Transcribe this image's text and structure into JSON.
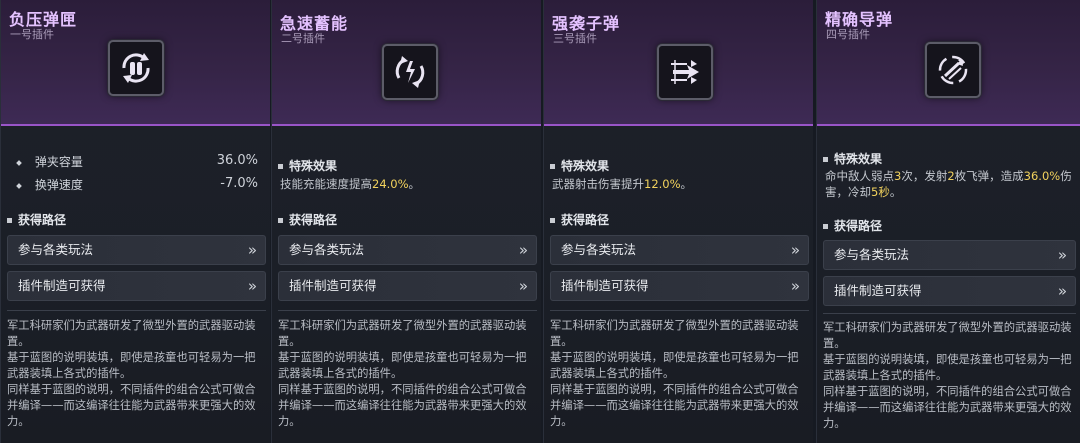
{
  "cards": [
    {
      "title": "负压弹匣",
      "subtitle": "一号插件",
      "icon": "ammo-cycle-icon",
      "stats": [
        {
          "label": "弹夹容量",
          "value": "36.0%"
        },
        {
          "label": "换弹速度",
          "value": "-7.0%"
        }
      ],
      "obtain_title": "获得路径",
      "buttons": [
        "参与各类玩法",
        "插件制造可获得"
      ],
      "description": [
        "军工科研家们为武器研发了微型外置的武器驱动装置。",
        "基于蓝图的说明装填，即使是孩童也可轻易为一把武器装填上各式的插件。",
        "同样基于蓝图的说明，不同插件的组合公式可做合并编译——而这编译往往能为武器带来更强大的效力。"
      ]
    },
    {
      "title": "急速蓄能",
      "subtitle": "二号插件",
      "icon": "energy-charge-icon",
      "effect_title": "特殊效果",
      "effect": {
        "pre": "技能充能速度提高",
        "hl": "24.0%",
        "post": "。"
      },
      "obtain_title": "获得路径",
      "buttons": [
        "参与各类玩法",
        "插件制造可获得"
      ],
      "description": [
        "军工科研家们为武器研发了微型外置的武器驱动装置。",
        "基于蓝图的说明装填，即使是孩童也可轻易为一把武器装填上各式的插件。",
        "同样基于蓝图的说明，不同插件的组合公式可做合并编译——而这编译往往能为武器带来更强大的效力。"
      ]
    },
    {
      "title": "强袭子弹",
      "subtitle": "三号插件",
      "icon": "assault-bullet-icon",
      "effect_title": "特殊效果",
      "effect": {
        "pre": "武器射击伤害提升",
        "hl": "12.0%",
        "post": "。"
      },
      "obtain_title": "获得路径",
      "buttons": [
        "参与各类玩法",
        "插件制造可获得"
      ],
      "description": [
        "军工科研家们为武器研发了微型外置的武器驱动装置。",
        "基于蓝图的说明装填，即使是孩童也可轻易为一把武器装填上各式的插件。",
        "同样基于蓝图的说明，不同插件的组合公式可做合并编译——而这编译往往能为武器带来更强大的效力。"
      ]
    },
    {
      "title": "精确导弹",
      "subtitle": "四号插件",
      "icon": "guided-missile-icon",
      "effect_title": "特殊效果",
      "effect_parts": [
        "命中敌人弱点",
        "3",
        "次，发射",
        "2",
        "枚飞弹，造成",
        "36.0%",
        "伤害，冷却",
        "5秒",
        "。"
      ],
      "obtain_title": "获得路径",
      "buttons": [
        "参与各类玩法",
        "插件制造可获得"
      ],
      "description": [
        "军工科研家们为武器研发了微型外置的武器驱动装置。",
        "基于蓝图的说明装填，即使是孩童也可轻易为一把武器装填上各式的插件。",
        "同样基于蓝图的说明，不同插件的组合公式可做合并编译——而这编译往往能为武器带来更强大的效力。"
      ]
    }
  ],
  "colors": {
    "highlight": "#f2d25d",
    "accent": "#9a55c8"
  }
}
